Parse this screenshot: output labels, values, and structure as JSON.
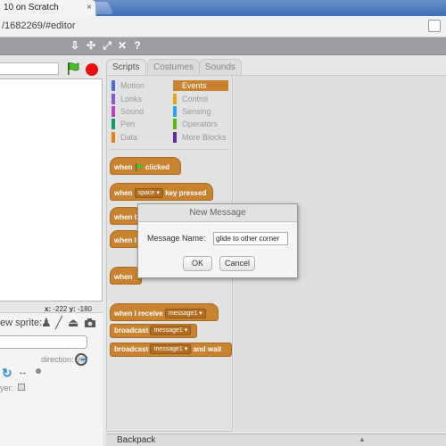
{
  "browser": {
    "tab_title": "10 on Scratch",
    "tab_close": "×",
    "url": "/1682269/#editor"
  },
  "toolbar_icons": [
    "upload-icon",
    "duplicate-icon",
    "fullscreen-icon",
    "shrink-icon",
    "help-icon"
  ],
  "stage": {
    "coord_x_label": "x:",
    "coord_x": "-222",
    "coord_y_label": "y:",
    "coord_y": "-180",
    "new_sprite_label": "ew sprite:",
    "direction_label": "direction:",
    "direction_value": "90°",
    "player_label": "yer:"
  },
  "tabs": [
    "Scripts",
    "Costumes",
    "Sounds"
  ],
  "categories_left": [
    {
      "label": "Motion",
      "color": "#4a6cd4"
    },
    {
      "label": "Looks",
      "color": "#8a55d7"
    },
    {
      "label": "Sound",
      "color": "#bb42c3"
    },
    {
      "label": "Pen",
      "color": "#0e9a6c"
    },
    {
      "label": "Data",
      "color": "#ee7d16"
    }
  ],
  "categories_right": [
    {
      "label": "Events",
      "color": "#c88330",
      "selected": true
    },
    {
      "label": "Control",
      "color": "#e1a91a"
    },
    {
      "label": "Sensing",
      "color": "#2ca5e2"
    },
    {
      "label": "Operators",
      "color": "#5cb712"
    },
    {
      "label": "More Blocks",
      "color": "#632d99"
    }
  ],
  "blocks": {
    "when_flag": {
      "pre": "when",
      "post": "clicked"
    },
    "when_key": {
      "pre": "when",
      "key": "space",
      "post": "key pressed"
    },
    "partial_1": "when t",
    "partial_2": "when I",
    "partial_3": "when",
    "when_receive": {
      "pre": "when I receive",
      "msg": "message1"
    },
    "broadcast": {
      "pre": "broadcast",
      "msg": "message1"
    },
    "broadcast_wait": {
      "pre": "broadcast",
      "msg": "message1",
      "post": "and wait"
    }
  },
  "backpack": {
    "label": "Backpack",
    "arrow": "▲"
  },
  "dialog": {
    "title": "New Message",
    "field_label": "Message Name:",
    "field_value": "glide to other corner",
    "ok": "OK",
    "cancel": "Cancel"
  }
}
